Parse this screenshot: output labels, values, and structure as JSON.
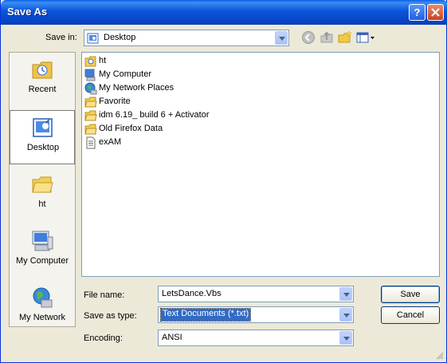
{
  "window": {
    "title": "Save As",
    "help_label": "?",
    "close_label": "✕"
  },
  "save_in": {
    "label": "Save in:",
    "value": "Desktop"
  },
  "toolbar": {
    "back_icon": "back-icon",
    "up_icon": "up-folder-icon",
    "new_folder_icon": "new-folder-icon",
    "views_icon": "views-menu-icon"
  },
  "places": [
    {
      "label": "Recent",
      "icon": "recent-icon"
    },
    {
      "label": "Desktop",
      "icon": "desktop-icon",
      "selected": true
    },
    {
      "label": "ht",
      "icon": "folder-icon"
    },
    {
      "label": "My Computer",
      "icon": "my-computer-icon"
    },
    {
      "label": "My Network",
      "icon": "my-network-icon"
    }
  ],
  "files": [
    {
      "name": "ht",
      "icon": "user-folder-icon"
    },
    {
      "name": "My Computer",
      "icon": "my-computer-icon"
    },
    {
      "name": "My Network Places",
      "icon": "network-places-icon"
    },
    {
      "name": "Favorite",
      "icon": "folder-icon"
    },
    {
      "name": "idm 6.19_ build 6 + Activator",
      "icon": "folder-icon"
    },
    {
      "name": "Old Firefox Data",
      "icon": "folder-icon"
    },
    {
      "name": "exAM",
      "icon": "text-file-icon"
    }
  ],
  "file_name": {
    "label": "File name:",
    "value": "LetsDance.Vbs"
  },
  "save_type": {
    "label": "Save as type:",
    "value": "Text Documents (*.txt)"
  },
  "encoding": {
    "label": "Encoding:",
    "value": "ANSI"
  },
  "buttons": {
    "save": "Save",
    "cancel": "Cancel"
  },
  "colors": {
    "titlebar": "#0a54d8",
    "selection": "#316ac5",
    "dialog_bg": "#ece9d8"
  }
}
